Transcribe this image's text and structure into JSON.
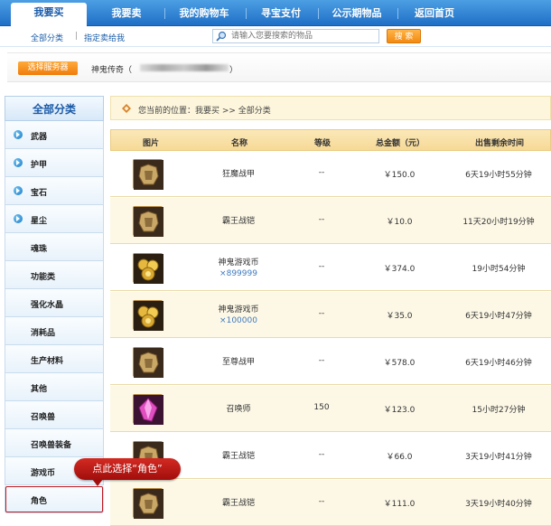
{
  "nav": {
    "tabs": [
      "我要买",
      "我要卖",
      "我的购物车",
      "寻宝支付",
      "公示期物品",
      "返回首页"
    ]
  },
  "subbar": {
    "all_categories": "全部分类",
    "separator": "|",
    "sell_to_me": "指定卖给我",
    "search_placeholder": "请输入您要搜索的物品",
    "search_button": "搜 索"
  },
  "server": {
    "select_button": "选择服务器",
    "game_name": "神鬼传奇（",
    "close_paren": "）"
  },
  "sidebar": {
    "title": "全部分类",
    "items": [
      "武器",
      "护甲",
      "宝石",
      "星尘",
      "魂珠",
      "功能类",
      "强化水晶",
      "消耗品",
      "生产材料",
      "其他",
      "召唤兽",
      "召唤兽装备",
      "游戏币",
      "角色"
    ]
  },
  "breadcrumb": "您当前的位置：我要买 >> 全部分类",
  "table": {
    "headers": [
      "图片",
      "名称",
      "等级",
      "总金额（元）",
      "出售剩余时间"
    ],
    "rows": [
      {
        "name": "狂魔战甲",
        "qty": "",
        "level": "--",
        "price": "￥150.0",
        "time": "6天19小时55分钟",
        "icon": "armor-icon"
      },
      {
        "name": "霸王战铠",
        "qty": "",
        "level": "--",
        "price": "￥10.0",
        "time": "11天20小时19分钟",
        "icon": "armor-icon"
      },
      {
        "name": "神鬼游戏币",
        "qty": "×899999",
        "level": "--",
        "price": "￥374.0",
        "time": "19小时54分钟",
        "icon": "coin-icon"
      },
      {
        "name": "神鬼游戏币",
        "qty": "×100000",
        "level": "--",
        "price": "￥35.0",
        "time": "6天19小时47分钟",
        "icon": "coin-icon"
      },
      {
        "name": "至尊战甲",
        "qty": "",
        "level": "--",
        "price": "￥578.0",
        "time": "6天19小时46分钟",
        "icon": "armor-icon"
      },
      {
        "name": "召唤师",
        "qty": "",
        "level": "150",
        "price": "￥123.0",
        "time": "15小时27分钟",
        "icon": "crystal-icon"
      },
      {
        "name": "霸王战铠",
        "qty": "",
        "level": "--",
        "price": "￥66.0",
        "time": "3天19小时41分钟",
        "icon": "armor-icon"
      },
      {
        "name": "霸王战铠",
        "qty": "",
        "level": "--",
        "price": "￥111.0",
        "time": "3天19小时40分钟",
        "icon": "armor-icon"
      }
    ]
  },
  "callout": "点此选择“角色”",
  "colors": {
    "nav_blue": "#1f6fc7",
    "accent_orange": "#f28a12",
    "callout_red": "#c0181f"
  }
}
